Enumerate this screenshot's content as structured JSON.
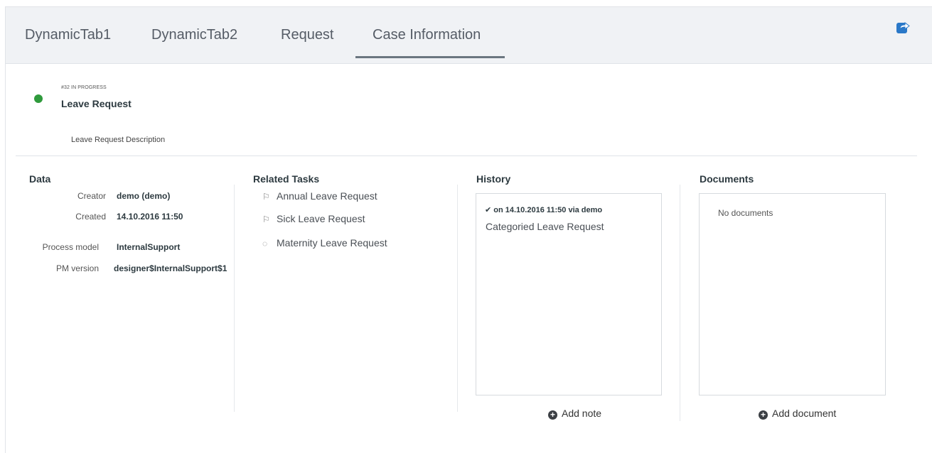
{
  "tabs": [
    {
      "label": "DynamicTab1"
    },
    {
      "label": "DynamicTab2"
    },
    {
      "label": "Request"
    },
    {
      "label": "Case Information",
      "active": true
    }
  ],
  "header": {
    "export_icon": "share-icon",
    "status_color": "#2f9a3c",
    "case_meta": "#32 IN PROGRESS",
    "case_title": "Leave Request",
    "description": "Leave Request Description"
  },
  "data_section": {
    "title": "Data",
    "rows": [
      {
        "label": "Creator",
        "value": "demo (demo)"
      },
      {
        "label": "Created",
        "value": "14.10.2016 11:50"
      },
      {
        "label": "Process model",
        "value": "InternalSupport"
      },
      {
        "label": "PM version",
        "value": "designer$InternalSupport$1"
      }
    ]
  },
  "related_tasks": {
    "title": "Related Tasks",
    "items": [
      {
        "icon": "flag-icon",
        "label": "Annual Leave Request"
      },
      {
        "icon": "flag-icon",
        "label": "Sick Leave Request"
      },
      {
        "icon": "spinner-icon",
        "label": "Maternity Leave Request"
      }
    ]
  },
  "history": {
    "title": "History",
    "entry_header": "✔ on 14.10.2016 11:50 via demo",
    "entry_text": "Categoried Leave Request",
    "add_label": "Add note"
  },
  "documents": {
    "title": "Documents",
    "empty_text": "No documents",
    "add_label": "Add document"
  }
}
